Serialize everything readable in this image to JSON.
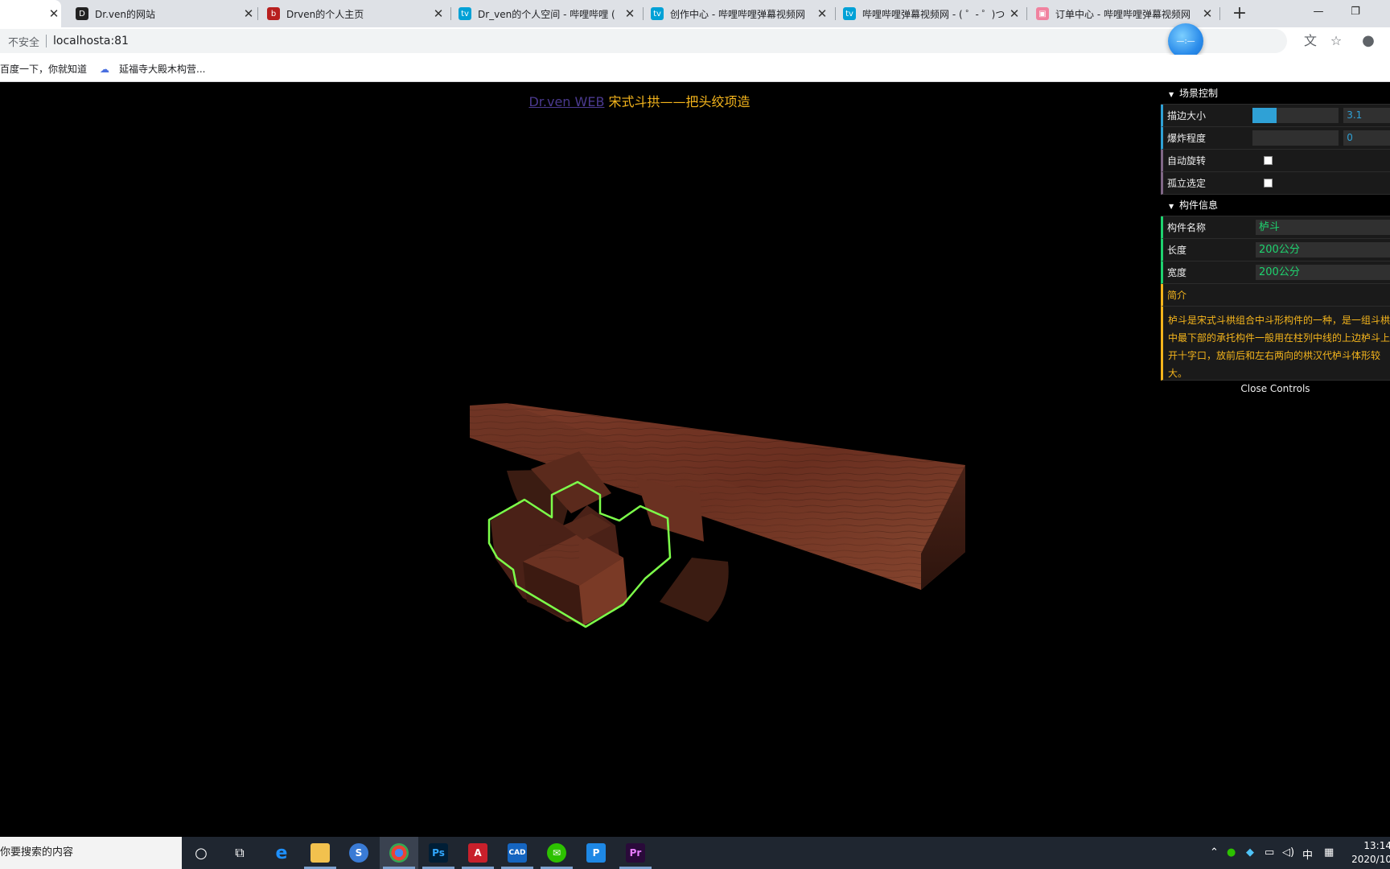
{
  "tabs": [
    {
      "title": "",
      "active": true
    },
    {
      "title": "Dr.ven的网站",
      "favicon": "dr-ven-logo"
    },
    {
      "title": "Drven的个人主页",
      "favicon": "red-logo"
    },
    {
      "title": "Dr_ven的个人空间 - 哔哩哔哩 (",
      "favicon": "bilibili-icon"
    },
    {
      "title": "创作中心 - 哔哩哔哩弹幕视频网",
      "favicon": "bilibili-icon"
    },
    {
      "title": "哔哩哔哩弹幕视频网 - ( ゜- ゜)つ",
      "favicon": "bilibili-icon"
    },
    {
      "title": "订单中心 - 哔哩哔哩弹幕视频网",
      "favicon": "bilibili-bag-icon"
    }
  ],
  "omnibox": {
    "security": "不安全",
    "url": "localhosta:81"
  },
  "extension_badge": "—:—",
  "bookmarks": [
    {
      "label": "百度一下，你就知道"
    },
    {
      "label": "延福寺大殿木构营..."
    }
  ],
  "scene": {
    "title_link": "Dr.ven WEB",
    "title_text": "宋式斗拱——把头绞项造",
    "outline_color": "#7dff4a",
    "wood_color": "#5a2a1e"
  },
  "gui": {
    "folder_scene": "场景控制",
    "outline_label": "描边大小",
    "outline_value": "3.1",
    "outline_fraction": 0.28,
    "explode_label": "爆炸程度",
    "explode_value": "0",
    "explode_fraction": 0,
    "autorotate_label": "自动旋转",
    "autorotate_checked": false,
    "isolate_label": "孤立选定",
    "isolate_checked": false,
    "folder_info": "构件信息",
    "name_label": "构件名称",
    "name_value": "栌斗",
    "length_label": "长度",
    "length_value": "200公分",
    "width_label": "宽度",
    "width_value": "200公分",
    "intro_label": "简介",
    "intro_line1": "栌斗是宋式斗栱组合中斗形构件的一种，是一组斗栱",
    "intro_line2": "中最下部的承托构件一般用在柱列中线的上边栌斗上",
    "intro_line3": "开十字口，放前后和左右两向的栱汉代栌斗体形较",
    "intro_line4": "大。",
    "close_controls": "Close Controls"
  },
  "taskbar": {
    "search_text": "你要搜索的内容",
    "ime": "中",
    "time": "13:14",
    "date": "2020/10"
  },
  "colors": {
    "gui_number": "#2fa1d6",
    "gui_string": "#1ed36f",
    "gui_intro": "#f5b51c",
    "gui_bool": "#806787"
  }
}
